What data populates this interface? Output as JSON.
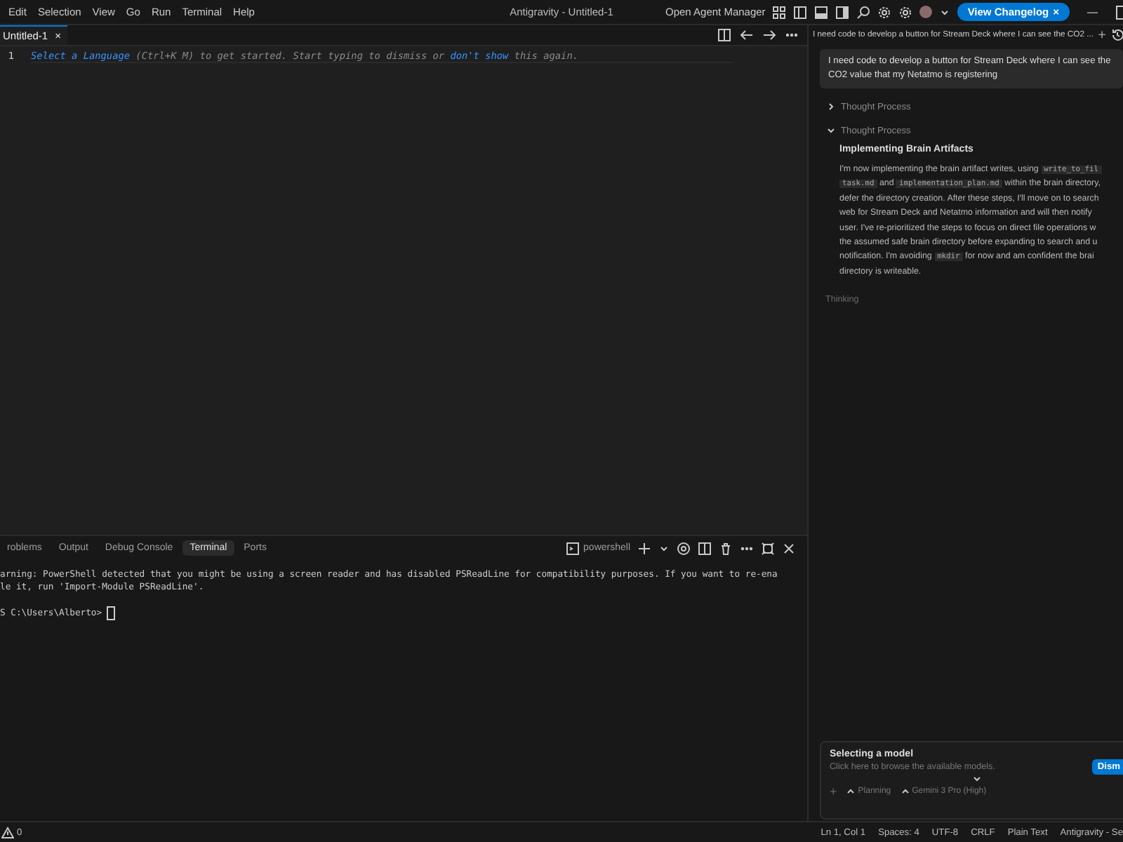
{
  "window": {
    "title": "Antigravity - Untitled-1"
  },
  "menu": [
    "Edit",
    "Selection",
    "View",
    "Go",
    "Run",
    "Terminal",
    "Help"
  ],
  "title_actions": {
    "agent_manager": "Open Agent Manager",
    "changelog": {
      "label": "View Changelog",
      "close": "×"
    },
    "minimize": "—"
  },
  "editor": {
    "tabs": [
      {
        "label": "Untitled-1",
        "close": "×",
        "selected": true
      }
    ],
    "lines": [
      {
        "number": "1",
        "parts": [
          {
            "kind": "link",
            "text": "Select a Language"
          },
          {
            "kind": "text",
            "text": " (Ctrl+K M) to get started. Start typing to dismiss or "
          },
          {
            "kind": "link",
            "text": "don't show"
          },
          {
            "kind": "text",
            "text": " this again."
          }
        ]
      }
    ]
  },
  "panel": {
    "tabs": [
      {
        "label": "roblems",
        "selected": false
      },
      {
        "label": "Output",
        "selected": false
      },
      {
        "label": "Debug Console",
        "selected": false
      },
      {
        "label": "Terminal",
        "selected": true
      },
      {
        "label": "Ports",
        "selected": false
      }
    ],
    "terminal_name": "powershell",
    "output": [
      "arning: PowerShell detected that you might be using a screen reader and has disabled PSReadLine for compatibility purposes. If you want to re-ena",
      "le it, run 'Import-Module PSReadLine'.",
      "S C:\\Users\\Alberto> "
    ]
  },
  "chat": {
    "title": "I need code to develop a button for Stream Deck where I can see the CO2 ...",
    "new": "+",
    "message": "I need code to develop a button for Stream Deck where I can see the CO2 value that my Netatmo is registering",
    "thoughts": [
      {
        "label": "Thought Process",
        "expanded": false
      },
      {
        "label": "Thought Process",
        "expanded": true,
        "heading": "Implementing Brain Artifacts",
        "lines": [
          [
            {
              "kind": "text",
              "text": "I'm now implementing the brain artifact writes, using "
            },
            {
              "kind": "code",
              "text": "write_to_fil"
            }
          ],
          [
            {
              "kind": "code",
              "text": "task.md"
            },
            {
              "kind": "text",
              "text": " and "
            },
            {
              "kind": "code",
              "text": "implementation_plan.md"
            },
            {
              "kind": "text",
              "text": " within the brain directory,"
            }
          ],
          [
            {
              "kind": "text",
              "text": "defer the directory creation. After these steps, I'll move on to search"
            }
          ],
          [
            {
              "kind": "text",
              "text": "web for Stream Deck and Netatmo information and will then notify"
            }
          ],
          [
            {
              "kind": "text",
              "text": "user. I've re-prioritized the steps to focus on direct file operations w"
            }
          ],
          [
            {
              "kind": "text",
              "text": "the assumed safe brain directory before expanding to search and u"
            }
          ],
          [
            {
              "kind": "text",
              "text": "notification. I'm avoiding "
            },
            {
              "kind": "code",
              "text": "mkdir"
            },
            {
              "kind": "text",
              "text": " for now and am confident the brai"
            }
          ],
          [
            {
              "kind": "text",
              "text": "directory is writeable."
            }
          ]
        ]
      }
    ],
    "status": "Thinking",
    "model_prompt": {
      "title": "Selecting a model",
      "text": "Click here to browse the available models.",
      "button": "Dism"
    },
    "input": {
      "add": "+",
      "modes": [
        "Planning",
        "Gemini 3 Pro (High)"
      ]
    }
  },
  "status_bar": {
    "problems": "0",
    "items": [
      "Ln 1, Col 1",
      "Spaces: 4",
      "UTF-8",
      "CRLF",
      "Plain Text",
      "Antigravity - Se"
    ]
  }
}
